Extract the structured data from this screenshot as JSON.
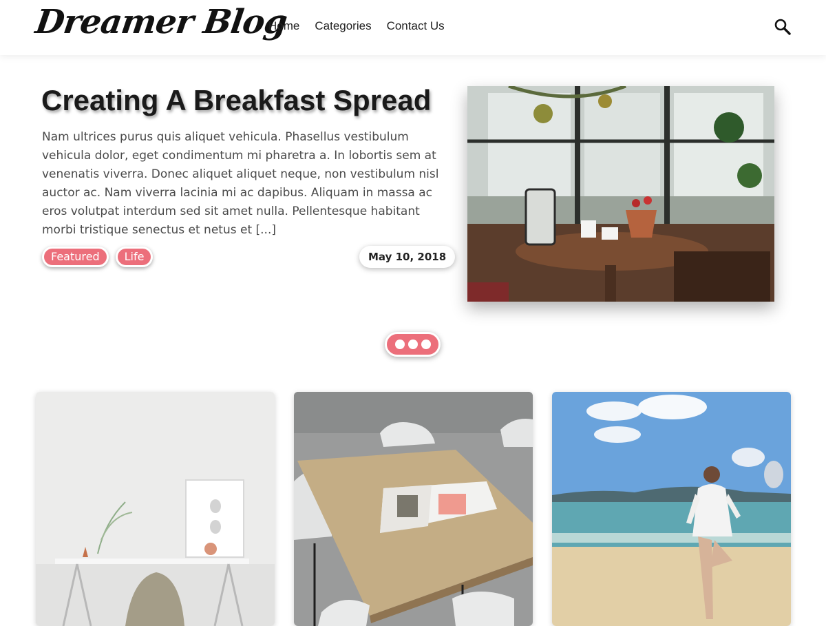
{
  "header": {
    "logo_text": "Dreamer Blog",
    "nav": [
      {
        "label": "Home"
      },
      {
        "label": "Categories"
      },
      {
        "label": "Contact Us"
      }
    ],
    "search_icon": "search-icon"
  },
  "featured": {
    "title": "Creating A Breakfast Spread",
    "excerpt": "Nam ultrices purus quis aliquet vehicula. Phasellus vestibulum vehicula dolor, eget condimentum mi pharetra a. In lobortis sem at venenatis viverra. Donec aliquet aliquet neque, non vestibulum nisl auctor ac. Nam viverra lacinia mi ac dapibus. Aliquam in massa ac eros volutpat interdum sed sit amet nulla. Pellentesque habitant morbi tristique senectus et netus et [...]",
    "tags": [
      {
        "label": "Featured"
      },
      {
        "label": "Life"
      }
    ],
    "date": "May 10, 2018"
  },
  "slider": {
    "dot_count": 3
  },
  "colors": {
    "accent": "#ec6f7b",
    "text": "#333333",
    "background": "#ffffff"
  }
}
